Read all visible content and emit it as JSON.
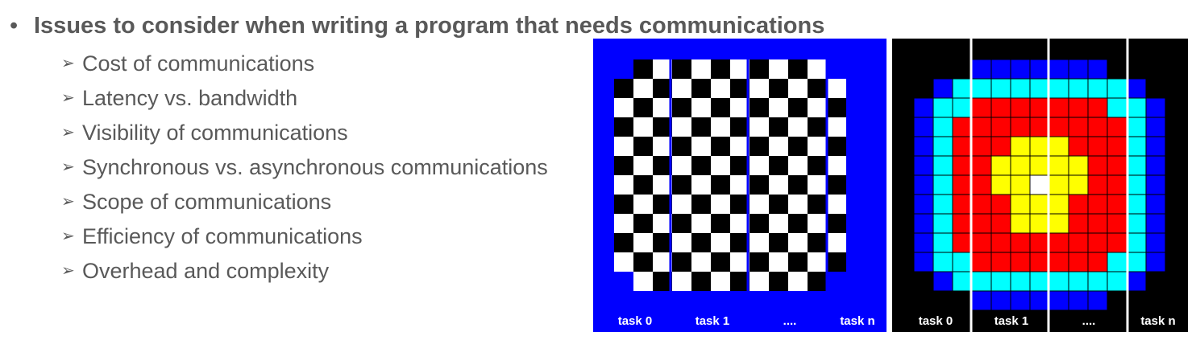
{
  "heading": {
    "bullet": "•",
    "text": "Issues to consider when writing a program that needs communications"
  },
  "items": [
    "Cost of communications",
    "Latency vs. bandwidth",
    "Visibility of communications",
    "Synchronous vs. asynchronous communications",
    "Scope of communications",
    "Efficiency of communications",
    "Overhead and complexity"
  ],
  "item_marker": "➢",
  "figure_left": {
    "labels": [
      "task 0",
      "task 1",
      "....",
      "task n"
    ],
    "colors": {
      "border": "#0000ff",
      "dark": "#000000",
      "light": "#ffffff"
    }
  },
  "figure_right": {
    "labels": [
      "task 0",
      "task 1",
      "....",
      "task n"
    ],
    "colors": {
      "background": "#000000",
      "ring1": "#0000ff",
      "ring2": "#00ffff",
      "ring3": "#ff0000",
      "ring4": "#ffff00",
      "center": "#ffffff",
      "grid": "#000000",
      "divider": "#ffffff"
    }
  }
}
